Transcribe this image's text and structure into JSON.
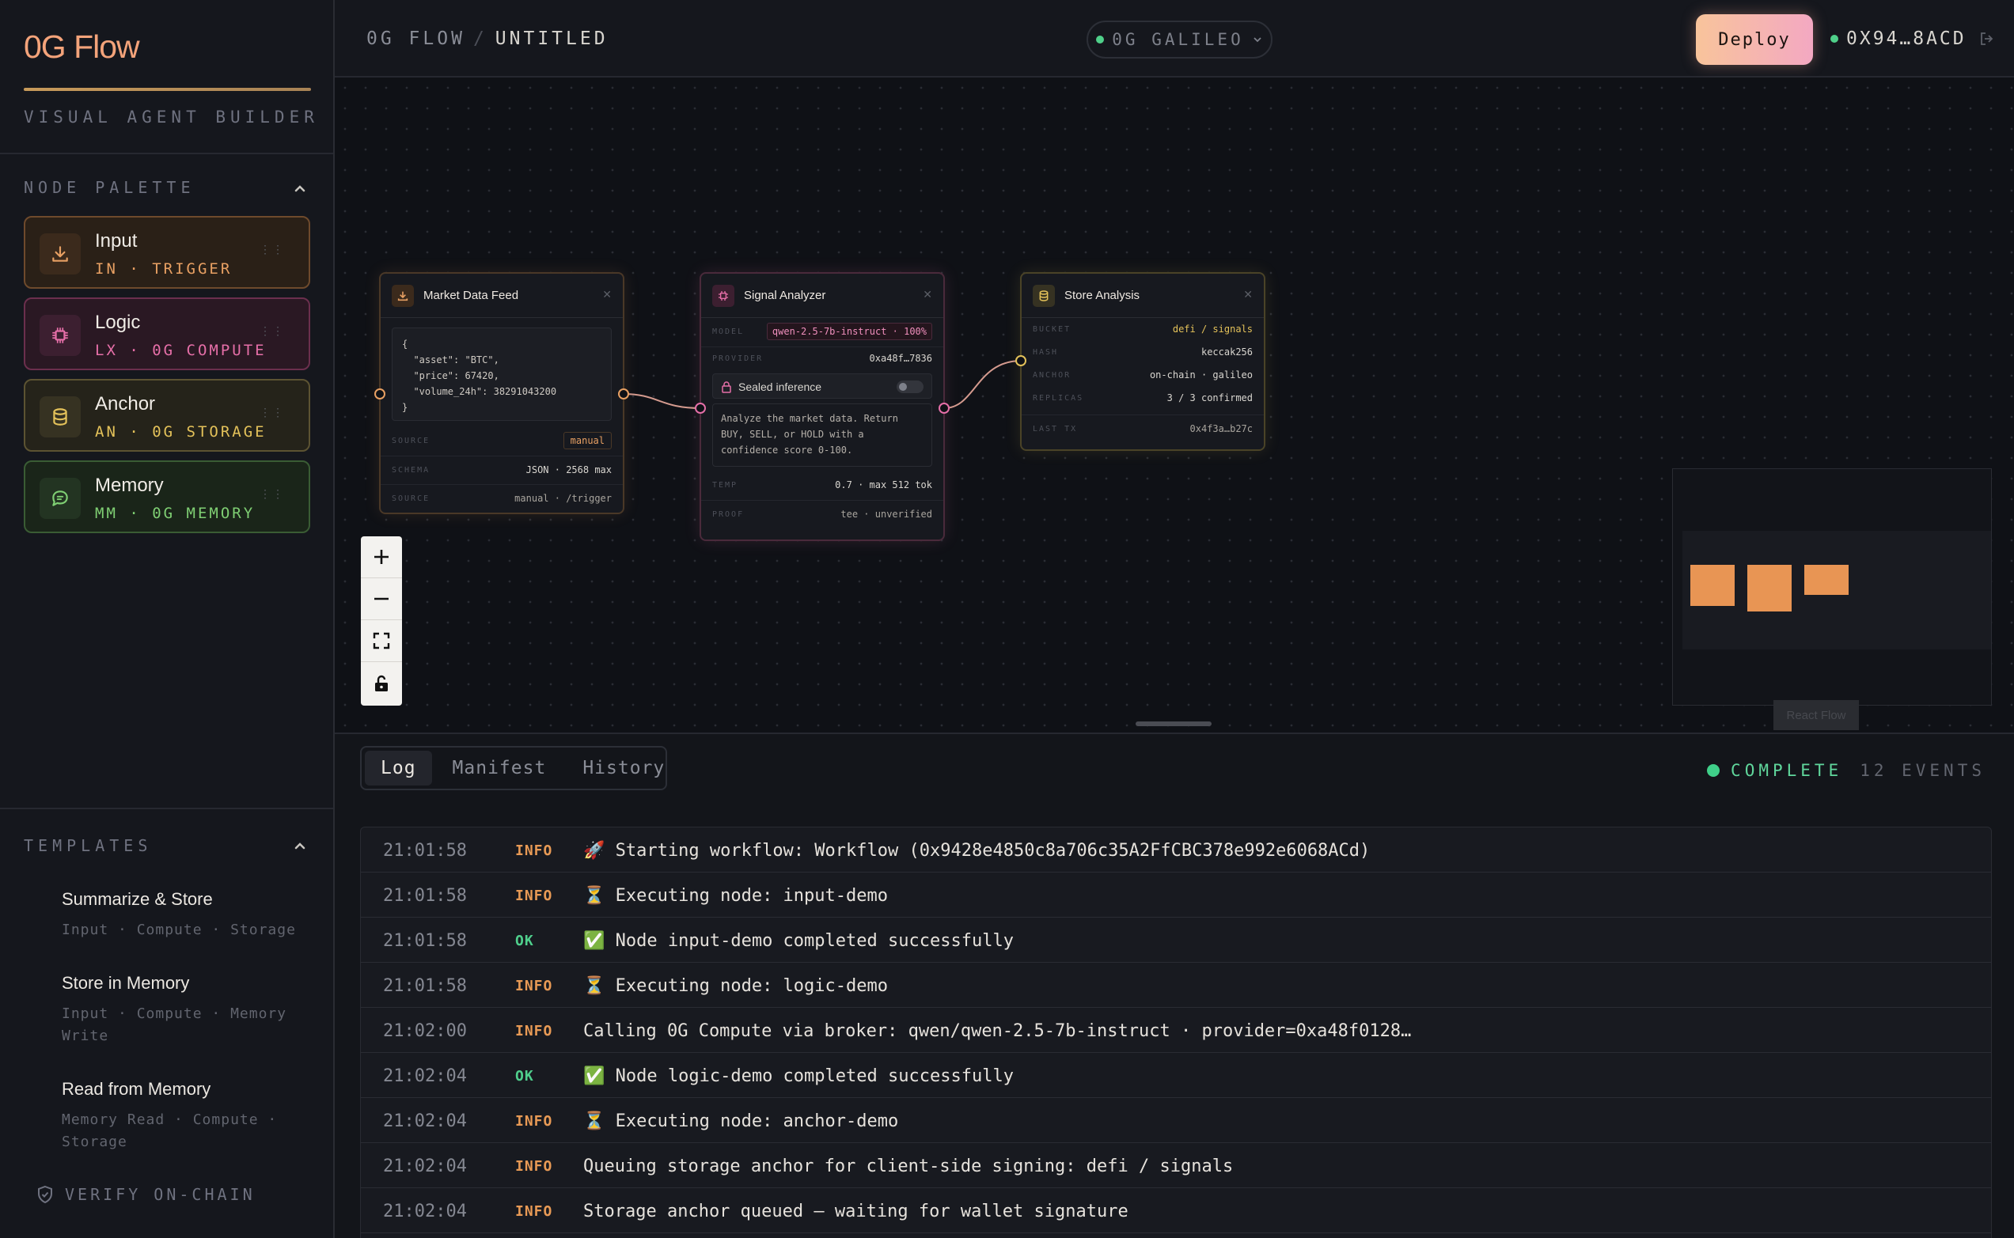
{
  "sidebar": {
    "brand": "0G Flow",
    "subtitle": "VISUAL AGENT BUILDER",
    "palette_title": "NODE PALETTE",
    "palette": [
      {
        "title": "Input",
        "sub": "IN · TRIGGER",
        "color": "#e8a063",
        "icon": "download-icon"
      },
      {
        "title": "Logic",
        "sub": "LX · 0G COMPUTE",
        "color": "#e66fa8",
        "icon": "chip-icon"
      },
      {
        "title": "Anchor",
        "sub": "AN · 0G STORAGE",
        "color": "#e4c25a",
        "icon": "database-icon"
      },
      {
        "title": "Memory",
        "sub": "MM · 0G MEMORY",
        "color": "#7fcf73",
        "icon": "chat-icon"
      }
    ],
    "templates_title": "TEMPLATES",
    "templates": [
      {
        "title": "Summarize & Store",
        "sub": "Input · Compute · Storage"
      },
      {
        "title": "Store in Memory",
        "sub": "Input · Compute · Memory Write"
      },
      {
        "title": "Read from Memory",
        "sub": "Memory Read · Compute · Storage"
      }
    ],
    "verify": "VERIFY ON-CHAIN"
  },
  "header": {
    "crumb_root": "0G FLOW",
    "crumb_sep": "/",
    "crumb_current": "UNTITLED",
    "network": "0G GALILEO",
    "deploy": "Deploy",
    "wallet": "0X94…8ACD"
  },
  "nodes": {
    "input": {
      "title": "Market Data Feed",
      "json_lines": [
        "{",
        "  \"asset\": \"BTC\",",
        "  \"price\": 67420,",
        "  \"volume_24h\": 38291043200",
        "}"
      ],
      "source_label": "SOURCE",
      "source_value": "manual",
      "schema_label": "SCHEMA",
      "schema_value": "JSON · 2568 max",
      "source2_label": "SOURCE",
      "source2_value": "manual · /trigger"
    },
    "logic": {
      "title": "Signal Analyzer",
      "model_label": "MODEL",
      "model_value": "qwen-2.5-7b-instruct · 100%",
      "provider_label": "PROVIDER",
      "provider_value": "0xa48f…7836",
      "sealed": "Sealed inference",
      "prompt": "Analyze the market data. Return BUY, SELL, or HOLD with a confidence score 0-100.",
      "temp_label": "TEMP",
      "temp_value": "0.7 · max 512 tok",
      "proof_label": "PROOF",
      "proof_value": "tee · unverified"
    },
    "anchor": {
      "title": "Store Analysis",
      "bucket_label": "BUCKET",
      "bucket_value": "defi / signals",
      "hash_label": "HASH",
      "hash_value": "keccak256",
      "anchor_label": "ANCHOR",
      "anchor_value": "on-chain · galileo",
      "replicas_label": "REPLICAS",
      "replicas_value": "3 / 3 confirmed",
      "lasttx_label": "LAST TX",
      "lasttx_value": "0x4f3a…b27c"
    }
  },
  "attribution": "React Flow",
  "panel": {
    "tabs": [
      "Log",
      "Manifest",
      "History"
    ],
    "status": "COMPLETE",
    "events": "12 EVENTS",
    "logs": [
      {
        "time": "21:01:58",
        "level": "INFO",
        "msg": "🚀 Starting workflow: Workflow (0x9428e4850c8a706c35A2FfCBC378e992e6068ACd)"
      },
      {
        "time": "21:01:58",
        "level": "INFO",
        "msg": "⏳ Executing node: input-demo"
      },
      {
        "time": "21:01:58",
        "level": "OK",
        "msg": "✅ Node input-demo completed successfully"
      },
      {
        "time": "21:01:58",
        "level": "INFO",
        "msg": "⏳ Executing node: logic-demo"
      },
      {
        "time": "21:02:00",
        "level": "INFO",
        "msg": "Calling 0G Compute via broker: qwen/qwen-2.5-7b-instruct · provider=0xa48f0128…"
      },
      {
        "time": "21:02:04",
        "level": "OK",
        "msg": "✅ Node logic-demo completed successfully"
      },
      {
        "time": "21:02:04",
        "level": "INFO",
        "msg": "⏳ Executing node: anchor-demo"
      },
      {
        "time": "21:02:04",
        "level": "INFO",
        "msg": "Queuing storage anchor for client-side signing: defi / signals"
      },
      {
        "time": "21:02:04",
        "level": "INFO",
        "msg": "Storage anchor queued — waiting for wallet signature"
      }
    ]
  },
  "colors": {
    "info": "#e89a55",
    "ok": "#4fcf8c",
    "accent": "#f3a37a"
  }
}
